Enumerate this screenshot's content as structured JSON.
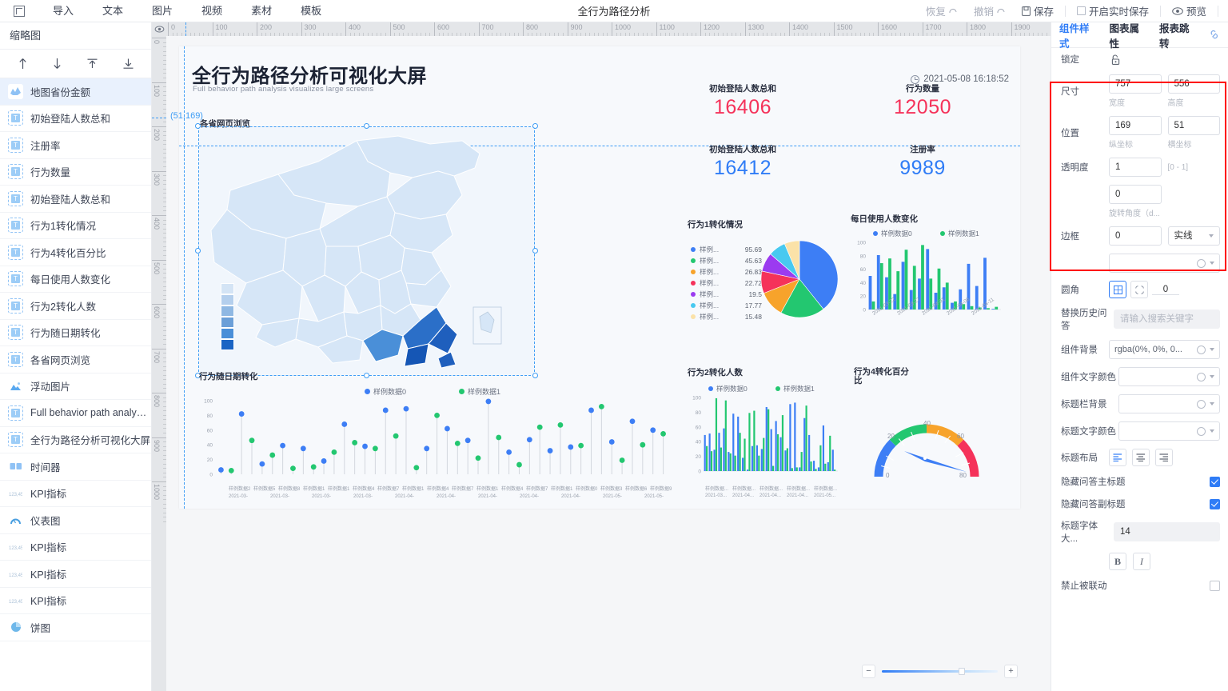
{
  "topbar": {
    "logo": "app-logo",
    "menus": [
      "导入",
      "文本",
      "图片",
      "视频",
      "素材",
      "模板"
    ],
    "doc_title": "全行为路径分析",
    "redo": "恢复",
    "undo": "撤销",
    "save": "保存",
    "realtime_save": "开启实时保存",
    "preview": "预览"
  },
  "left": {
    "title": "缩略图",
    "tools": [
      "move-up",
      "move-down",
      "bring-top",
      "send-bottom"
    ],
    "items": [
      {
        "label": "地图省份金额",
        "icon": "map-icon",
        "selected": true
      },
      {
        "label": "初始登陆人数总和",
        "icon": "text-icon"
      },
      {
        "label": "注册率",
        "icon": "text-icon"
      },
      {
        "label": "行为数量",
        "icon": "text-icon"
      },
      {
        "label": "初始登陆人数总和",
        "icon": "text-icon"
      },
      {
        "label": "行为1转化情况",
        "icon": "text-icon"
      },
      {
        "label": "行为4转化百分比",
        "icon": "text-icon"
      },
      {
        "label": "每日使用人数变化",
        "icon": "text-icon"
      },
      {
        "label": "行为2转化人数",
        "icon": "text-icon"
      },
      {
        "label": "行为随日期转化",
        "icon": "text-icon"
      },
      {
        "label": "各省网页浏览",
        "icon": "text-icon"
      },
      {
        "label": "浮动图片",
        "icon": "image-icon"
      },
      {
        "label": "Full behavior path analysis...",
        "icon": "text-icon"
      },
      {
        "label": "全行为路径分析可视化大屏",
        "icon": "text-icon"
      },
      {
        "label": "时间器",
        "icon": "timer-icon"
      },
      {
        "label": "KPI指标",
        "icon": "kpi-icon"
      },
      {
        "label": "仪表图",
        "icon": "gauge-icon"
      },
      {
        "label": "KPI指标",
        "icon": "kpi-icon"
      },
      {
        "label": "KPI指标",
        "icon": "kpi-icon"
      },
      {
        "label": "KPI指标",
        "icon": "kpi-icon"
      },
      {
        "label": "饼图",
        "icon": "pie-icon"
      }
    ]
  },
  "rulers": {
    "h_ticks": [
      0,
      100,
      200,
      300,
      400,
      500,
      600,
      700,
      800,
      900,
      1000,
      1100,
      1200,
      1300,
      1400,
      1500,
      1600,
      1700,
      1800,
      1900
    ],
    "v_ticks": [
      0,
      100,
      200,
      300,
      400,
      500,
      600,
      700,
      800,
      900,
      1000
    ],
    "cursor_coord": "(51,169)"
  },
  "dashboard": {
    "title": "全行为路径分析可视化大屏",
    "subtitle": "Full behavior path analysis visualizes large screens",
    "timestamp": "2021-05-08 16:18:52",
    "map_caption": "各省网页浏览",
    "kpis": [
      {
        "label": "初始登陆人数总和",
        "value": "16406",
        "color": "#f5325a"
      },
      {
        "label": "行为数量",
        "value": "12050",
        "color": "#f5325a"
      },
      {
        "label": "初始登陆人数总和",
        "value": "16412",
        "color": "#2f7cf6"
      },
      {
        "label": "注册率",
        "value": "9989",
        "color": "#2f7cf6"
      }
    ]
  },
  "chart_data": [
    {
      "type": "pie",
      "title": "行为1转化情况",
      "legend_position": "left",
      "labels": [
        "样例...",
        "样例...",
        "样例...",
        "样例...",
        "样例...",
        "样例...",
        "样例..."
      ],
      "values": [
        95.69,
        45.63,
        26.83,
        22.72,
        19.5,
        17.77,
        15.48
      ],
      "colors": [
        "#3d7ef5",
        "#23c770",
        "#f7a32b",
        "#f5325a",
        "#9b3bf0",
        "#48c9f0",
        "#fbe2a8"
      ]
    },
    {
      "type": "bar",
      "title": "每日使用人数变化",
      "ylabel": "",
      "xlabel": "",
      "ylim": [
        0,
        100
      ],
      "yticks": [
        0,
        20,
        40,
        60,
        80,
        100
      ],
      "xticks": [
        "2021-03-22",
        "2021-03-27",
        "2021-04-01",
        "2021-04-06",
        "2021-04-11"
      ],
      "legend": [
        "样例数据0",
        "样例数据1"
      ],
      "colors": [
        "#3d7ef5",
        "#23c770"
      ],
      "series": [
        {
          "name": "样例数据0",
          "values": [
            50,
            81,
            48,
            23,
            71,
            29,
            46,
            90,
            25,
            33,
            10,
            30,
            68,
            35,
            77,
            1
          ]
        },
        {
          "name": "样例数据1",
          "values": [
            12,
            69,
            76,
            57,
            89,
            65,
            96,
            46,
            61,
            40,
            12,
            8,
            5,
            3,
            2,
            4
          ]
        }
      ]
    },
    {
      "type": "bar",
      "title": "行为2转化人数",
      "ylim": [
        0,
        100
      ],
      "yticks": [
        0,
        20,
        40,
        60,
        80,
        100
      ],
      "xticks": [
        "样例数据...",
        "样例数据...",
        "样例数据...",
        "样例数据...",
        "样例数据..."
      ],
      "xticks2": [
        "2021-03...",
        "2021-04...",
        "2021-04...",
        "2021-04...",
        "2021-05..."
      ],
      "legend": [
        "样例数据0",
        "样例数据1"
      ],
      "colors": [
        "#3d7ef5",
        "#23c770"
      ],
      "series": [
        {
          "name": "样例数据0",
          "values": [
            49,
            51,
            29,
            52,
            58,
            26,
            78,
            74,
            18,
            2,
            34,
            35,
            30,
            87,
            57,
            68,
            46,
            28,
            91,
            93,
            5,
            72,
            49,
            14,
            5,
            62,
            12,
            29
          ]
        },
        {
          "name": "样例数据1",
          "values": [
            34,
            27,
            99,
            32,
            96,
            24,
            21,
            52,
            44,
            79,
            82,
            21,
            45,
            84,
            7,
            50,
            76,
            31,
            4,
            5,
            26,
            89,
            13,
            3,
            35,
            10,
            48,
            2
          ]
        }
      ]
    },
    {
      "type": "gauge",
      "title": "行为4转化百分比",
      "min": 0,
      "max": 80,
      "ticks": [
        0,
        20,
        40,
        60,
        80
      ],
      "value": 63,
      "band_colors": [
        "#3d7ef5",
        "#23c770",
        "#f7a32b",
        "#f5325a"
      ]
    },
    {
      "type": "scatter",
      "title": "行为随日期转化",
      "ylim": [
        0,
        100
      ],
      "yticks": [
        0,
        20,
        40,
        60,
        80,
        100
      ],
      "legend": [
        "样例数据0",
        "样例数据1"
      ],
      "colors": [
        "#3d7ef5",
        "#23c770"
      ],
      "xticks": [
        "样例数据2",
        "样例数据5",
        "样例数据8",
        "样例数据1",
        "样例数据1",
        "样例数据4",
        "样例数据7",
        "样例数据1",
        "样例数据4",
        "样例数据7",
        "样例数据1",
        "样例数据4",
        "样例数据7",
        "样例数据1",
        "样例数据0",
        "样例数据3",
        "样例数据6",
        "样例数据9"
      ],
      "xticks2": [
        "2021-03-",
        "2021-03-",
        "2021-03-",
        "2021-03-",
        "2021-04-",
        "2021-04-",
        "2021-04-",
        "2021-04-",
        "2021-04-",
        "2021-05-",
        "2021-05-"
      ],
      "series": [
        {
          "name": "样例数据0",
          "values": [
            6,
            82,
            14,
            39,
            35,
            18,
            68,
            38,
            87,
            89,
            35,
            62,
            46,
            99,
            30,
            47,
            32,
            37,
            87,
            44,
            72,
            60
          ]
        },
        {
          "name": "样例数据1",
          "values": [
            5,
            46,
            26,
            8,
            10,
            30,
            43,
            35,
            52,
            9,
            80,
            42,
            22,
            50,
            13,
            64,
            67,
            39,
            92,
            19,
            40,
            55
          ]
        }
      ]
    }
  ],
  "right": {
    "tabs": [
      {
        "label": "组件样式",
        "active": true
      },
      {
        "label": "图表属性",
        "active": false
      },
      {
        "label": "报表跳转",
        "active": false
      }
    ],
    "link_icon": "link-icon",
    "lock": {
      "label": "锁定",
      "icon": "unlock-icon"
    },
    "size": {
      "label": "尺寸",
      "width": "757",
      "height": "556",
      "hint_w": "宽度",
      "hint_h": "高度"
    },
    "position": {
      "label": "位置",
      "x": "169",
      "y": "51",
      "hint_x": "纵坐标",
      "hint_y": "横坐标"
    },
    "opacity": {
      "label": "透明度",
      "value": "1",
      "hint": "[0 - 1]"
    },
    "rotation": {
      "value": "0",
      "hint": "旋转角度（d..."
    },
    "border": {
      "label": "边框",
      "width": "0",
      "style": "实线"
    },
    "radius": {
      "label": "圆角",
      "value": "0"
    },
    "replace_qa": {
      "label": "替换历史问答",
      "placeholder": "请输入搜索关键字"
    },
    "comp_bg": {
      "label": "组件背景",
      "value": "rgba(0%, 0%, 0..."
    },
    "comp_text_color": {
      "label": "组件文字颜色",
      "value": ""
    },
    "title_bar_bg": {
      "label": "标题栏背景",
      "value": ""
    },
    "title_text_color": {
      "label": "标题文字颜色",
      "value": ""
    },
    "title_layout": {
      "label": "标题布局"
    },
    "hide_main_title": {
      "label": "隐藏问答主标题",
      "checked": true
    },
    "hide_sub_title": {
      "label": "隐藏问答副标题",
      "checked": true
    },
    "title_font_size": {
      "label": "标题字体大...",
      "value": "14"
    },
    "bold": "B",
    "italic": "I",
    "no_linkage": {
      "label": "禁止被联动",
      "checked": false
    }
  },
  "zoom": {
    "minus": "−",
    "plus": "+",
    "value": 66
  }
}
